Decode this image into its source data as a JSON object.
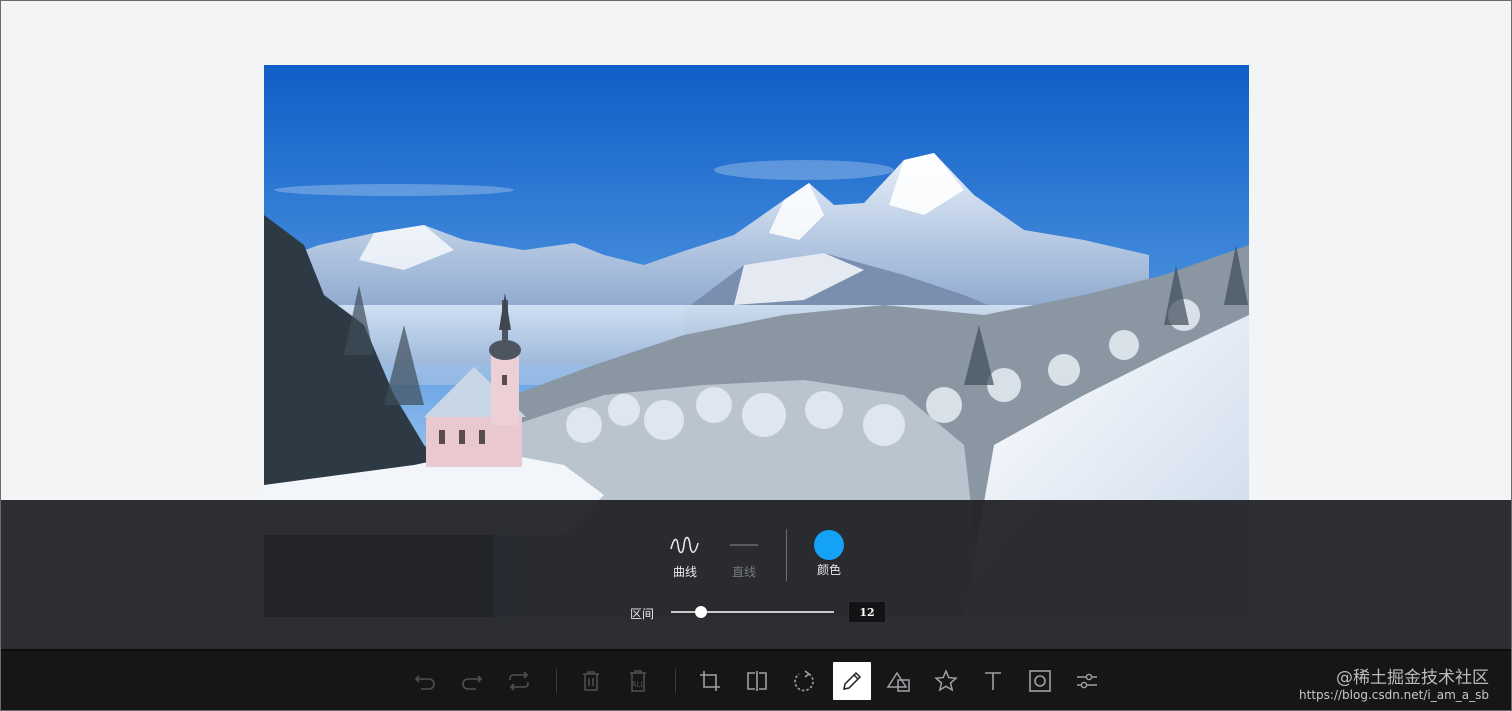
{
  "draw_submenu": {
    "options": {
      "curve_label": "曲线",
      "line_label": "直线",
      "color_label": "颜色"
    },
    "selected_color": "#14a2f7",
    "range": {
      "label": "区间",
      "value": "12",
      "min": 1,
      "max": 60
    }
  },
  "toolbar": {
    "tools": [
      {
        "name": "undo-icon",
        "state": "disabled"
      },
      {
        "name": "redo-icon",
        "state": "disabled"
      },
      {
        "name": "reset-icon",
        "state": "enabled"
      },
      {
        "name": "delete-icon",
        "state": "disabled"
      },
      {
        "name": "delete-all-icon",
        "state": "disabled",
        "text": "ALL"
      },
      {
        "name": "crop-icon",
        "state": "enabled"
      },
      {
        "name": "flip-icon",
        "state": "enabled"
      },
      {
        "name": "rotate-icon",
        "state": "enabled"
      },
      {
        "name": "draw-icon",
        "state": "active"
      },
      {
        "name": "shape-icon",
        "state": "enabled"
      },
      {
        "name": "icon-icon",
        "state": "enabled"
      },
      {
        "name": "text-icon",
        "state": "enabled"
      },
      {
        "name": "mask-icon",
        "state": "enabled"
      },
      {
        "name": "filter-icon",
        "state": "enabled"
      }
    ],
    "delete_all_text": "ALL"
  },
  "watermark": {
    "brand": "@稀土掘金技术社区",
    "url": "https://blog.csdn.net/i_am_a_sb"
  },
  "colors": {
    "accent": "#14a2f7",
    "toolbar_bg": "#161617",
    "panel_bg": "#222326",
    "workspace_bg": "#f3f4f6"
  }
}
